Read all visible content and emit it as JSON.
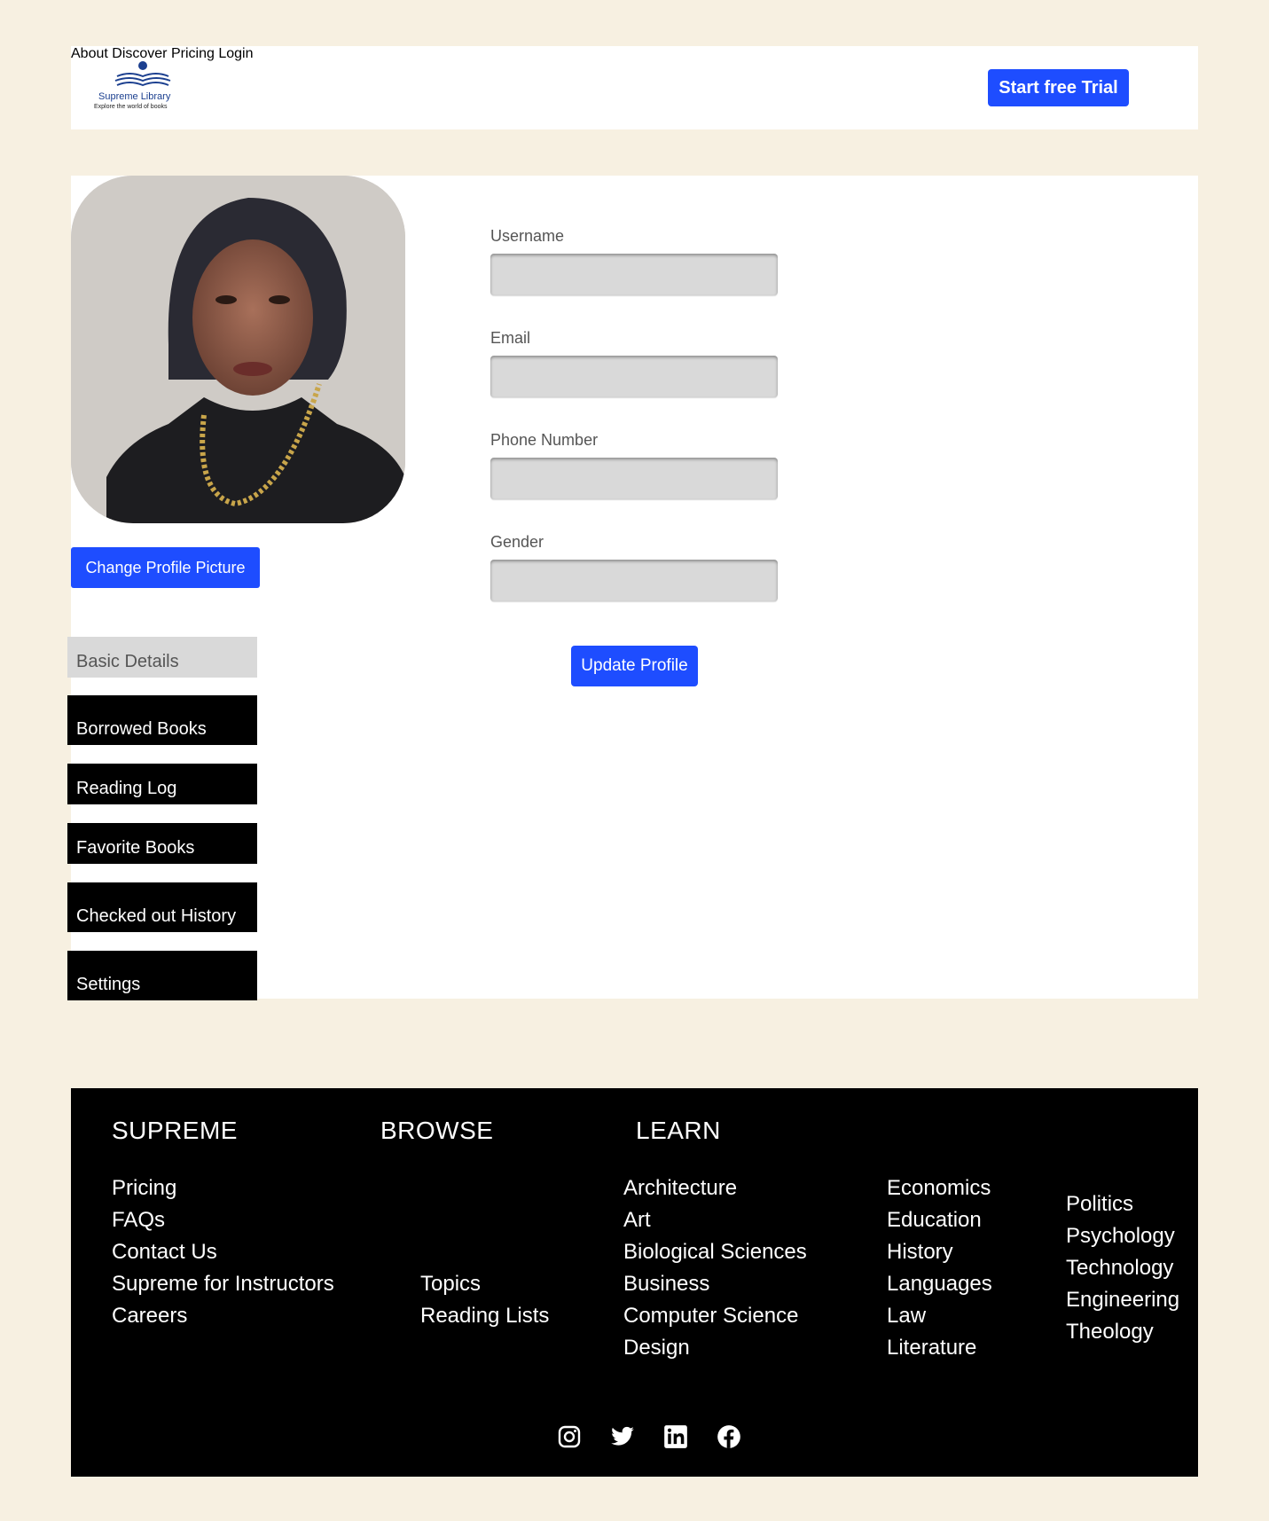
{
  "header": {
    "logo_name": "Supreme Library",
    "logo_tagline": "Explore the world of books",
    "nav": [
      "About",
      "Discover",
      "Pricing",
      "Login"
    ],
    "cta": "Start free Trial"
  },
  "profile": {
    "change_picture": "Change Profile Picture",
    "fields": [
      {
        "label": "Username",
        "value": ""
      },
      {
        "label": "Email",
        "value": ""
      },
      {
        "label": "Phone Number",
        "value": ""
      },
      {
        "label": "Gender",
        "value": ""
      }
    ],
    "update_button": "Update Profile"
  },
  "sidebar": {
    "items": [
      "Basic Details",
      "Borrowed Books",
      "Reading Log",
      "Favorite Books",
      "Checked out History",
      "Settings"
    ],
    "active_index": 0
  },
  "footer": {
    "headings": [
      "SUPREME",
      "BROWSE",
      "LEARN"
    ],
    "supreme_links": [
      "Pricing",
      "FAQs",
      "Contact Us",
      "Supreme for Instructors",
      "Careers"
    ],
    "browse_links": [
      "Topics",
      "Reading Lists"
    ],
    "learn_col1": [
      "Architecture",
      "Art",
      "Biological Sciences",
      "Business",
      "Computer Science",
      "Design"
    ],
    "learn_col2": [
      "Economics",
      "Education",
      "History",
      "Languages",
      "Law",
      "Literature"
    ],
    "learn_col3": [
      "Politics",
      "Psychology",
      "Technology",
      "Engineering",
      "Theology"
    ],
    "social_icons": [
      "instagram-icon",
      "twitter-icon",
      "linkedin-icon",
      "facebook-icon"
    ]
  },
  "colors": {
    "background": "#f7f0e1",
    "accent": "#1e4dff",
    "sidebar": "#000000",
    "active_tab": "#d9d9d9"
  }
}
